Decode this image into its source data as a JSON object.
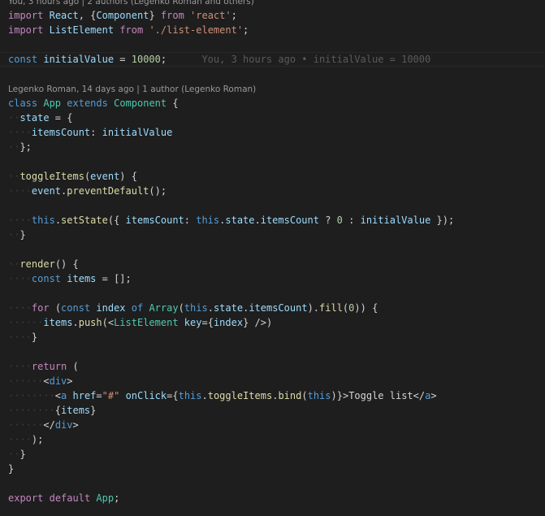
{
  "codelens": {
    "top": "You, 3 hours ago | 2 authors (Legenko Roman and others)",
    "class": "Legenko Roman, 14 days ago | 1 author (Legenko Roman)"
  },
  "blame": {
    "line4": "You, 3 hours ago • initialValue = 10000"
  },
  "code": {
    "l1": {
      "t1": "import",
      "t2": "React",
      "t3": "Component",
      "t4": "from",
      "t5": "'react'"
    },
    "l2": {
      "t1": "import",
      "t2": "ListElement",
      "t3": "from",
      "t4": "'./list-element'"
    },
    "l4": {
      "t1": "const",
      "t2": "initialValue",
      "t3": "10000"
    },
    "l7": {
      "t1": "class",
      "t2": "App",
      "t3": "extends",
      "t4": "Component"
    },
    "l8": {
      "t1": "state"
    },
    "l9": {
      "t1": "itemsCount",
      "t2": "initialValue"
    },
    "l12": {
      "t1": "toggleItems",
      "t2": "event"
    },
    "l13": {
      "t1": "event",
      "t2": "preventDefault"
    },
    "l15": {
      "t1": "this",
      "t2": "setState",
      "t3": "itemsCount",
      "t4": "this",
      "t5": "state",
      "t6": "itemsCount",
      "t7": "0",
      "t8": "initialValue"
    },
    "l18": {
      "t1": "render"
    },
    "l19": {
      "t1": "const",
      "t2": "items"
    },
    "l21": {
      "t1": "for",
      "t2": "const",
      "t3": "index",
      "t4": "of",
      "t5": "Array",
      "t6": "this",
      "t7": "state",
      "t8": "itemsCount",
      "t9": "fill",
      "t10": "0"
    },
    "l22": {
      "t1": "items",
      "t2": "push",
      "t3": "ListElement",
      "t4": "key",
      "t5": "index"
    },
    "l25": {
      "t1": "return"
    },
    "l26": {
      "t1": "div"
    },
    "l27": {
      "t1": "a",
      "t2": "href",
      "t3": "\"#\"",
      "t4": "onClick",
      "t5": "this",
      "t6": "toggleItems",
      "t7": "bind",
      "t8": "this",
      "t9": "Toggle list",
      "t10": "a"
    },
    "l28": {
      "t1": "items"
    },
    "l29": {
      "t1": "div"
    },
    "l34": {
      "t1": "export",
      "t2": "default",
      "t3": "App"
    }
  }
}
